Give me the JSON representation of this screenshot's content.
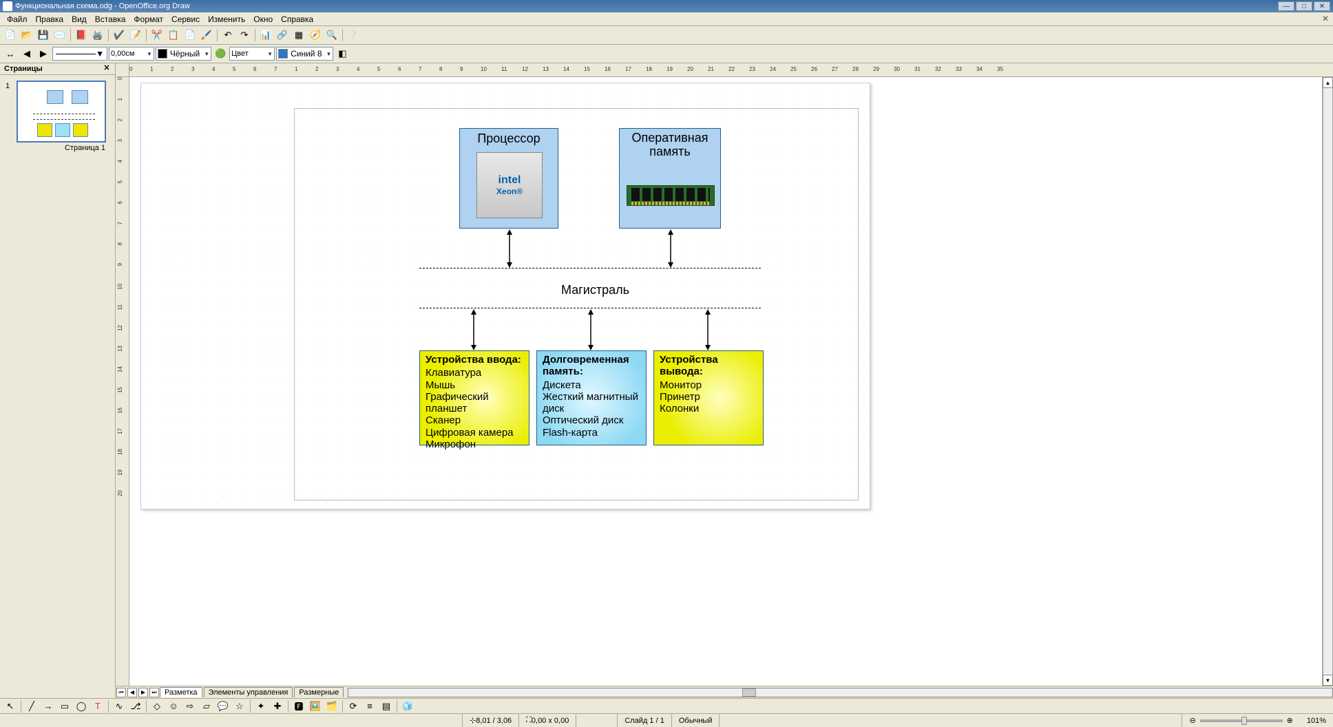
{
  "window": {
    "title": "Функциональная схема.odg - OpenOffice.org Draw",
    "minimize": "—",
    "maximize": "□",
    "close": "✕"
  },
  "menu": {
    "items": [
      "Файл",
      "Правка",
      "Вид",
      "Вставка",
      "Формат",
      "Сервис",
      "Изменить",
      "Окно",
      "Справка"
    ],
    "close_x": "✕"
  },
  "toolbar2": {
    "width_value": "0,00см",
    "linecolor_label": "Чёрный",
    "fill_placeholder": "Цвет",
    "fill_value": "Синий 8"
  },
  "slide_panel": {
    "title": "Страницы",
    "close": "✕",
    "slide_number": "1",
    "slide_label": "Страница 1"
  },
  "ruler_h": [
    "0",
    "1",
    "2",
    "3",
    "4",
    "5",
    "6",
    "7",
    "1",
    "2",
    "3",
    "4",
    "5",
    "6",
    "7",
    "8",
    "9",
    "10",
    "11",
    "12",
    "13",
    "14",
    "15",
    "16",
    "17",
    "18",
    "19",
    "20",
    "21",
    "22",
    "23",
    "24",
    "25",
    "26",
    "27",
    "28",
    "29",
    "30",
    "31",
    "32",
    "33",
    "34",
    "35"
  ],
  "ruler_v": [
    "0",
    "1",
    "2",
    "3",
    "4",
    "5",
    "6",
    "7",
    "8",
    "9",
    "10",
    "11",
    "12",
    "13",
    "14",
    "15",
    "16",
    "17",
    "18",
    "19",
    "20"
  ],
  "diagram": {
    "processor": {
      "title": "Процессор",
      "chip_brand": "intel",
      "chip_model": "Xeon®"
    },
    "ram": {
      "title": "Оперативная память"
    },
    "bus_label": "Магистраль",
    "input_devices": {
      "title": "Устройства ввода:",
      "items": [
        "Клавиатура",
        "Мышь",
        "Графический планшет",
        "Сканер",
        "Цифровая камера",
        "Микрофон"
      ]
    },
    "storage": {
      "title": "Долговременная память:",
      "items": [
        "Дискета",
        "Жесткий магнитный диск",
        "Оптический диск",
        "Flash-карта"
      ]
    },
    "output_devices": {
      "title": "Устройства вывода:",
      "items": [
        "Монитор",
        "Принетр",
        "Колонки"
      ]
    }
  },
  "canvas_tabs": {
    "tabs": [
      "Разметка",
      "Элементы управления",
      "Размерные"
    ]
  },
  "status": {
    "pos": "8,01 / 3,06",
    "size": "0,00 x 0,00",
    "slide": "Слайд 1 / 1",
    "mode": "Обычный",
    "zoom_minus": "⊖",
    "zoom_plus": "⊕",
    "zoom_value": "101%"
  }
}
